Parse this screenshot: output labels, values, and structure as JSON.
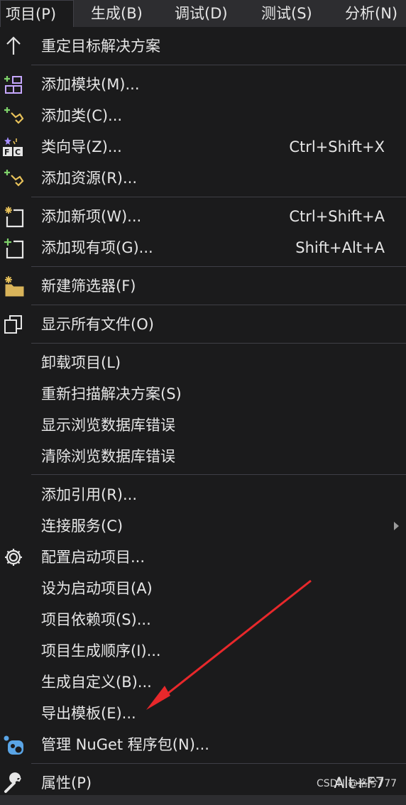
{
  "menubar": [
    {
      "label": "项目(P)",
      "active": true
    },
    {
      "label": "生成(B)"
    },
    {
      "label": "调试(D)"
    },
    {
      "label": "测试(S)"
    },
    {
      "label": "分析(N)"
    }
  ],
  "menu": {
    "items": [
      {
        "label": "重定目标解决方案",
        "icon": "arrow-up-icon"
      },
      {
        "label": "添加模块(M)...",
        "icon": "add-module-icon"
      },
      {
        "label": "添加类(C)...",
        "icon": "add-class-icon"
      },
      {
        "label": "类向导(Z)...",
        "shortcut": "Ctrl+Shift+X",
        "icon": "class-wizard-icon"
      },
      {
        "label": "添加资源(R)...",
        "icon": "add-resource-icon"
      },
      {
        "label": "添加新项(W)...",
        "shortcut": "Ctrl+Shift+A",
        "icon": "new-item-icon"
      },
      {
        "label": "添加现有项(G)...",
        "shortcut": "Shift+Alt+A",
        "icon": "existing-item-icon"
      },
      {
        "label": "新建筛选器(F)",
        "icon": "new-filter-folder-icon"
      },
      {
        "label": "显示所有文件(O)",
        "icon": "show-all-files-icon"
      },
      {
        "label": "卸载项目(L)"
      },
      {
        "label": "重新扫描解决方案(S)"
      },
      {
        "label": "显示浏览数据库错误"
      },
      {
        "label": "清除浏览数据库错误"
      },
      {
        "label": "添加引用(R)..."
      },
      {
        "label": "连接服务(C)",
        "submenu": true
      },
      {
        "label": "配置启动项目...",
        "icon": "gear-icon"
      },
      {
        "label": "设为启动项目(A)"
      },
      {
        "label": "项目依赖项(S)..."
      },
      {
        "label": "项目生成顺序(I)..."
      },
      {
        "label": "生成自定义(B)..."
      },
      {
        "label": "导出模板(E)..."
      },
      {
        "label": "管理 NuGet 程序包(N)...",
        "icon": "nuget-icon"
      },
      {
        "label": "属性(P)",
        "shortcut": "Alt+F7",
        "icon": "wrench-icon"
      }
    ]
  },
  "watermark": "CSDN @洛兮777",
  "colors": {
    "menu_bg": "#1b1b1c",
    "bar_bg": "#2d2d30",
    "separator": "#3f3f46",
    "annotation_arrow": "#e8282b"
  }
}
